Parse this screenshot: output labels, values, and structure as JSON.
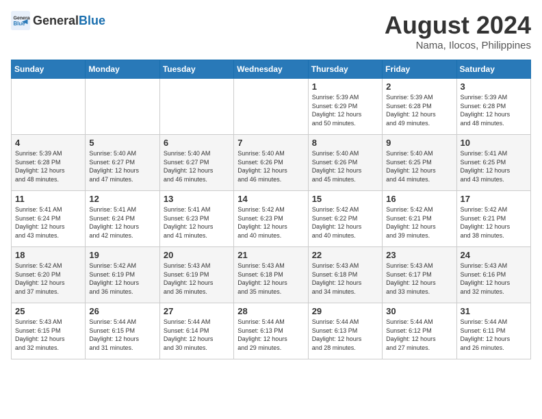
{
  "header": {
    "logo_general": "General",
    "logo_blue": "Blue",
    "title": "August 2024",
    "subtitle": "Nama, Ilocos, Philippines"
  },
  "days_of_week": [
    "Sunday",
    "Monday",
    "Tuesday",
    "Wednesday",
    "Thursday",
    "Friday",
    "Saturday"
  ],
  "weeks": [
    [
      {
        "day": "",
        "info": ""
      },
      {
        "day": "",
        "info": ""
      },
      {
        "day": "",
        "info": ""
      },
      {
        "day": "",
        "info": ""
      },
      {
        "day": "1",
        "info": "Sunrise: 5:39 AM\nSunset: 6:29 PM\nDaylight: 12 hours\nand 50 minutes."
      },
      {
        "day": "2",
        "info": "Sunrise: 5:39 AM\nSunset: 6:28 PM\nDaylight: 12 hours\nand 49 minutes."
      },
      {
        "day": "3",
        "info": "Sunrise: 5:39 AM\nSunset: 6:28 PM\nDaylight: 12 hours\nand 48 minutes."
      }
    ],
    [
      {
        "day": "4",
        "info": "Sunrise: 5:39 AM\nSunset: 6:28 PM\nDaylight: 12 hours\nand 48 minutes."
      },
      {
        "day": "5",
        "info": "Sunrise: 5:40 AM\nSunset: 6:27 PM\nDaylight: 12 hours\nand 47 minutes."
      },
      {
        "day": "6",
        "info": "Sunrise: 5:40 AM\nSunset: 6:27 PM\nDaylight: 12 hours\nand 46 minutes."
      },
      {
        "day": "7",
        "info": "Sunrise: 5:40 AM\nSunset: 6:26 PM\nDaylight: 12 hours\nand 46 minutes."
      },
      {
        "day": "8",
        "info": "Sunrise: 5:40 AM\nSunset: 6:26 PM\nDaylight: 12 hours\nand 45 minutes."
      },
      {
        "day": "9",
        "info": "Sunrise: 5:40 AM\nSunset: 6:25 PM\nDaylight: 12 hours\nand 44 minutes."
      },
      {
        "day": "10",
        "info": "Sunrise: 5:41 AM\nSunset: 6:25 PM\nDaylight: 12 hours\nand 43 minutes."
      }
    ],
    [
      {
        "day": "11",
        "info": "Sunrise: 5:41 AM\nSunset: 6:24 PM\nDaylight: 12 hours\nand 43 minutes."
      },
      {
        "day": "12",
        "info": "Sunrise: 5:41 AM\nSunset: 6:24 PM\nDaylight: 12 hours\nand 42 minutes."
      },
      {
        "day": "13",
        "info": "Sunrise: 5:41 AM\nSunset: 6:23 PM\nDaylight: 12 hours\nand 41 minutes."
      },
      {
        "day": "14",
        "info": "Sunrise: 5:42 AM\nSunset: 6:23 PM\nDaylight: 12 hours\nand 40 minutes."
      },
      {
        "day": "15",
        "info": "Sunrise: 5:42 AM\nSunset: 6:22 PM\nDaylight: 12 hours\nand 40 minutes."
      },
      {
        "day": "16",
        "info": "Sunrise: 5:42 AM\nSunset: 6:21 PM\nDaylight: 12 hours\nand 39 minutes."
      },
      {
        "day": "17",
        "info": "Sunrise: 5:42 AM\nSunset: 6:21 PM\nDaylight: 12 hours\nand 38 minutes."
      }
    ],
    [
      {
        "day": "18",
        "info": "Sunrise: 5:42 AM\nSunset: 6:20 PM\nDaylight: 12 hours\nand 37 minutes."
      },
      {
        "day": "19",
        "info": "Sunrise: 5:42 AM\nSunset: 6:19 PM\nDaylight: 12 hours\nand 36 minutes."
      },
      {
        "day": "20",
        "info": "Sunrise: 5:43 AM\nSunset: 6:19 PM\nDaylight: 12 hours\nand 36 minutes."
      },
      {
        "day": "21",
        "info": "Sunrise: 5:43 AM\nSunset: 6:18 PM\nDaylight: 12 hours\nand 35 minutes."
      },
      {
        "day": "22",
        "info": "Sunrise: 5:43 AM\nSunset: 6:18 PM\nDaylight: 12 hours\nand 34 minutes."
      },
      {
        "day": "23",
        "info": "Sunrise: 5:43 AM\nSunset: 6:17 PM\nDaylight: 12 hours\nand 33 minutes."
      },
      {
        "day": "24",
        "info": "Sunrise: 5:43 AM\nSunset: 6:16 PM\nDaylight: 12 hours\nand 32 minutes."
      }
    ],
    [
      {
        "day": "25",
        "info": "Sunrise: 5:43 AM\nSunset: 6:15 PM\nDaylight: 12 hours\nand 32 minutes."
      },
      {
        "day": "26",
        "info": "Sunrise: 5:44 AM\nSunset: 6:15 PM\nDaylight: 12 hours\nand 31 minutes."
      },
      {
        "day": "27",
        "info": "Sunrise: 5:44 AM\nSunset: 6:14 PM\nDaylight: 12 hours\nand 30 minutes."
      },
      {
        "day": "28",
        "info": "Sunrise: 5:44 AM\nSunset: 6:13 PM\nDaylight: 12 hours\nand 29 minutes."
      },
      {
        "day": "29",
        "info": "Sunrise: 5:44 AM\nSunset: 6:13 PM\nDaylight: 12 hours\nand 28 minutes."
      },
      {
        "day": "30",
        "info": "Sunrise: 5:44 AM\nSunset: 6:12 PM\nDaylight: 12 hours\nand 27 minutes."
      },
      {
        "day": "31",
        "info": "Sunrise: 5:44 AM\nSunset: 6:11 PM\nDaylight: 12 hours\nand 26 minutes."
      }
    ]
  ]
}
